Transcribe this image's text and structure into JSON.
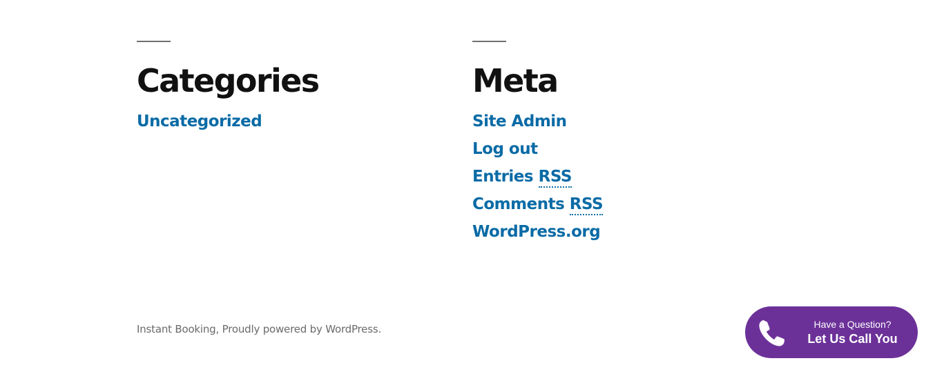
{
  "widgets": {
    "categories": {
      "title": "Categories",
      "items": [
        "Uncategorized"
      ]
    },
    "meta": {
      "title": "Meta",
      "items": [
        {
          "label": "Site Admin"
        },
        {
          "label": "Log out"
        },
        {
          "label": "Entries ",
          "abbr": "RSS"
        },
        {
          "label": "Comments ",
          "abbr": "RSS"
        },
        {
          "label": "WordPress.org"
        }
      ]
    }
  },
  "footer": {
    "site_name": "Instant Booking",
    "separator": ", ",
    "powered_by": "Proudly powered by WordPress."
  },
  "call_widget": {
    "line1": "Have a Question?",
    "line2": "Let Us Call You",
    "icon": "phone-icon",
    "background_color": "#6c3199"
  },
  "colors": {
    "link": "#0a6ba6",
    "heading": "#111111",
    "footer_text": "#6a6a6a"
  }
}
